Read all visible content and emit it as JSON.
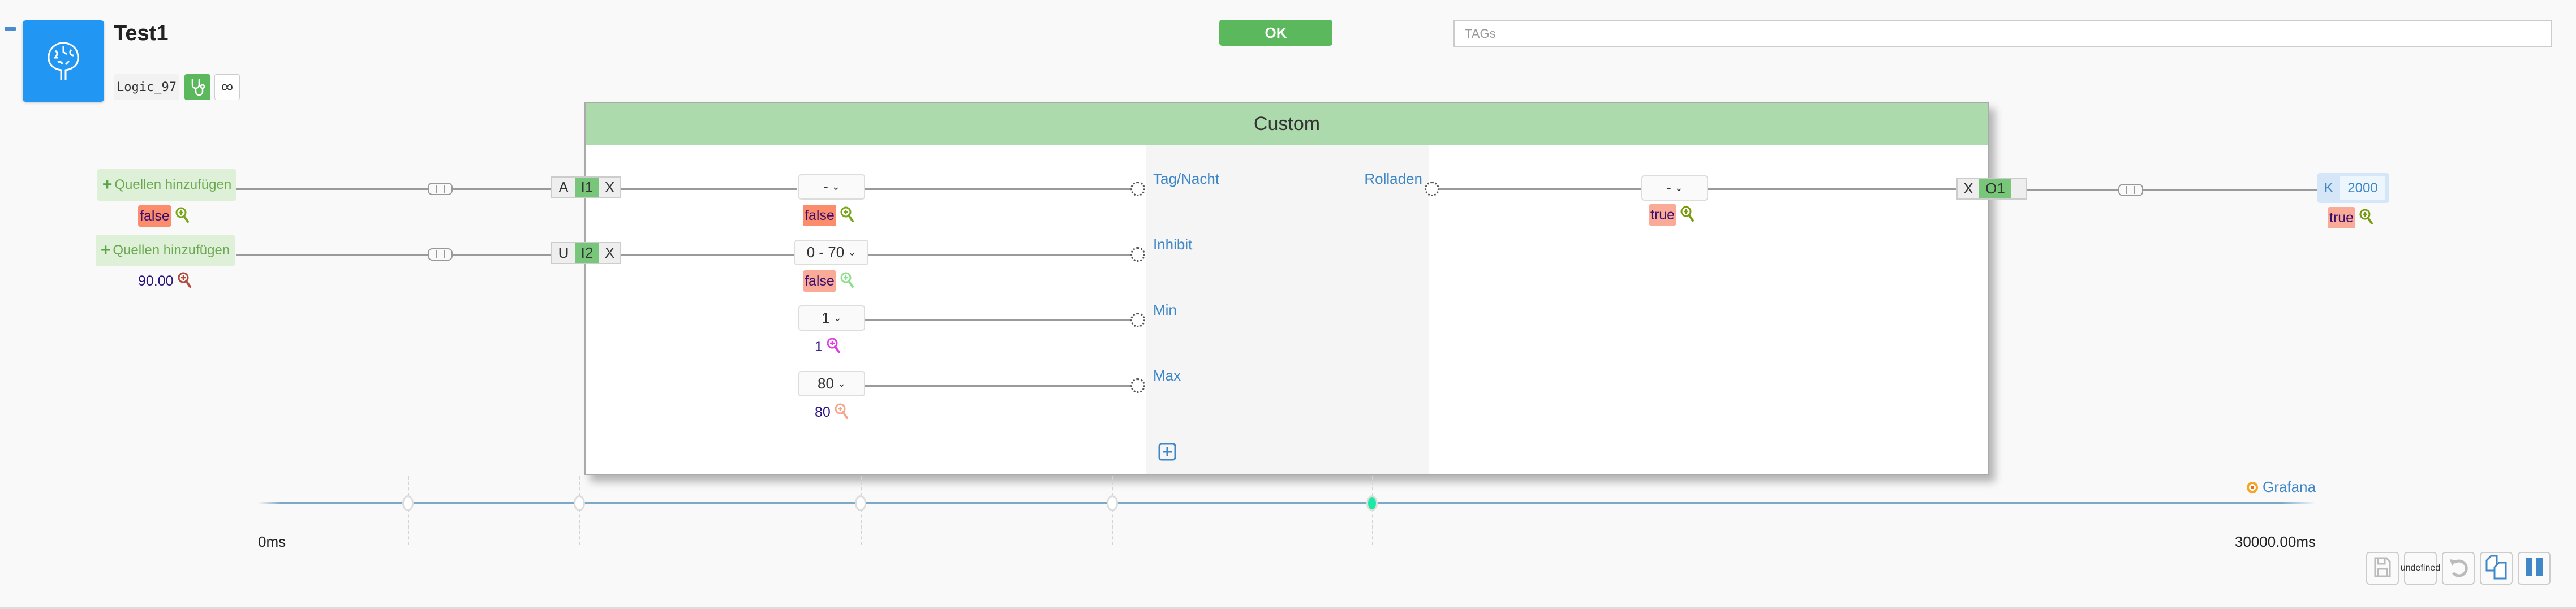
{
  "header": {
    "title": "Test1",
    "logic_id": "Logic_97",
    "icon": "brain-icon",
    "ok_label": "OK",
    "tags_placeholder": "TAGs"
  },
  "inputs": [
    {
      "source_label": "Quellen hinzufügen",
      "value": "false",
      "value_bg": "#fb8c6c",
      "icon_color": "#7aa61a",
      "port_prefix": "A",
      "port_name": "I1",
      "remove": "X"
    },
    {
      "source_label": "Quellen hinzufügen",
      "value": "90.00",
      "value_bg": "",
      "icon_color": "#b04a3a",
      "port_prefix": "U",
      "port_name": "I2",
      "remove": "X"
    }
  ],
  "block": {
    "title": "Custom",
    "params": [
      {
        "dropdown": "-",
        "value": "false",
        "value_bg": "#fb8c6c",
        "icon_color": "#7aa61a",
        "label": "Tag/Nacht"
      },
      {
        "dropdown": "0 - 70",
        "value": "false",
        "value_bg": "#f9ab98",
        "icon_color": "#8fe08f",
        "label": "Inhibit"
      },
      {
        "dropdown": "1",
        "value": "1",
        "value_bg": "",
        "icon_color": "#e040e0",
        "label": "Min"
      },
      {
        "dropdown": "80",
        "value": "80",
        "value_bg": "",
        "icon_color": "#f4a58a",
        "label": "Max"
      }
    ],
    "outputs": [
      {
        "label": "Rolladen",
        "dropdown": "-",
        "value": "true",
        "value_bg": "#f9ab98",
        "icon_color": "#7a9a10",
        "remove": "X",
        "port_name": "O1"
      }
    ],
    "add_icon": "plus-square-icon"
  },
  "target": {
    "prefix": "K",
    "value": "2000",
    "state": "true",
    "state_bg": "#f9ab98",
    "icon_color": "#7a9a10"
  },
  "timeline": {
    "start": "0ms",
    "end": "30000.00ms",
    "grafana_label": "Grafana",
    "active_handle": 4
  },
  "toolbar": [
    {
      "name": "save",
      "icon": "save-icon",
      "enabled": false
    },
    {
      "name": "delete",
      "icon": "trash-icon",
      "enabled": true
    },
    {
      "name": "undo",
      "icon": "undo-icon",
      "enabled": false
    },
    {
      "name": "copy",
      "icon": "copy-icon",
      "enabled": true
    },
    {
      "name": "pause",
      "icon": "pause-icon",
      "enabled": true
    }
  ],
  "colors": {
    "accent": "#2196f3",
    "ok": "#5cb85c",
    "header": "#addaac",
    "port_active": "#78c679",
    "link": "#3f87c7"
  }
}
